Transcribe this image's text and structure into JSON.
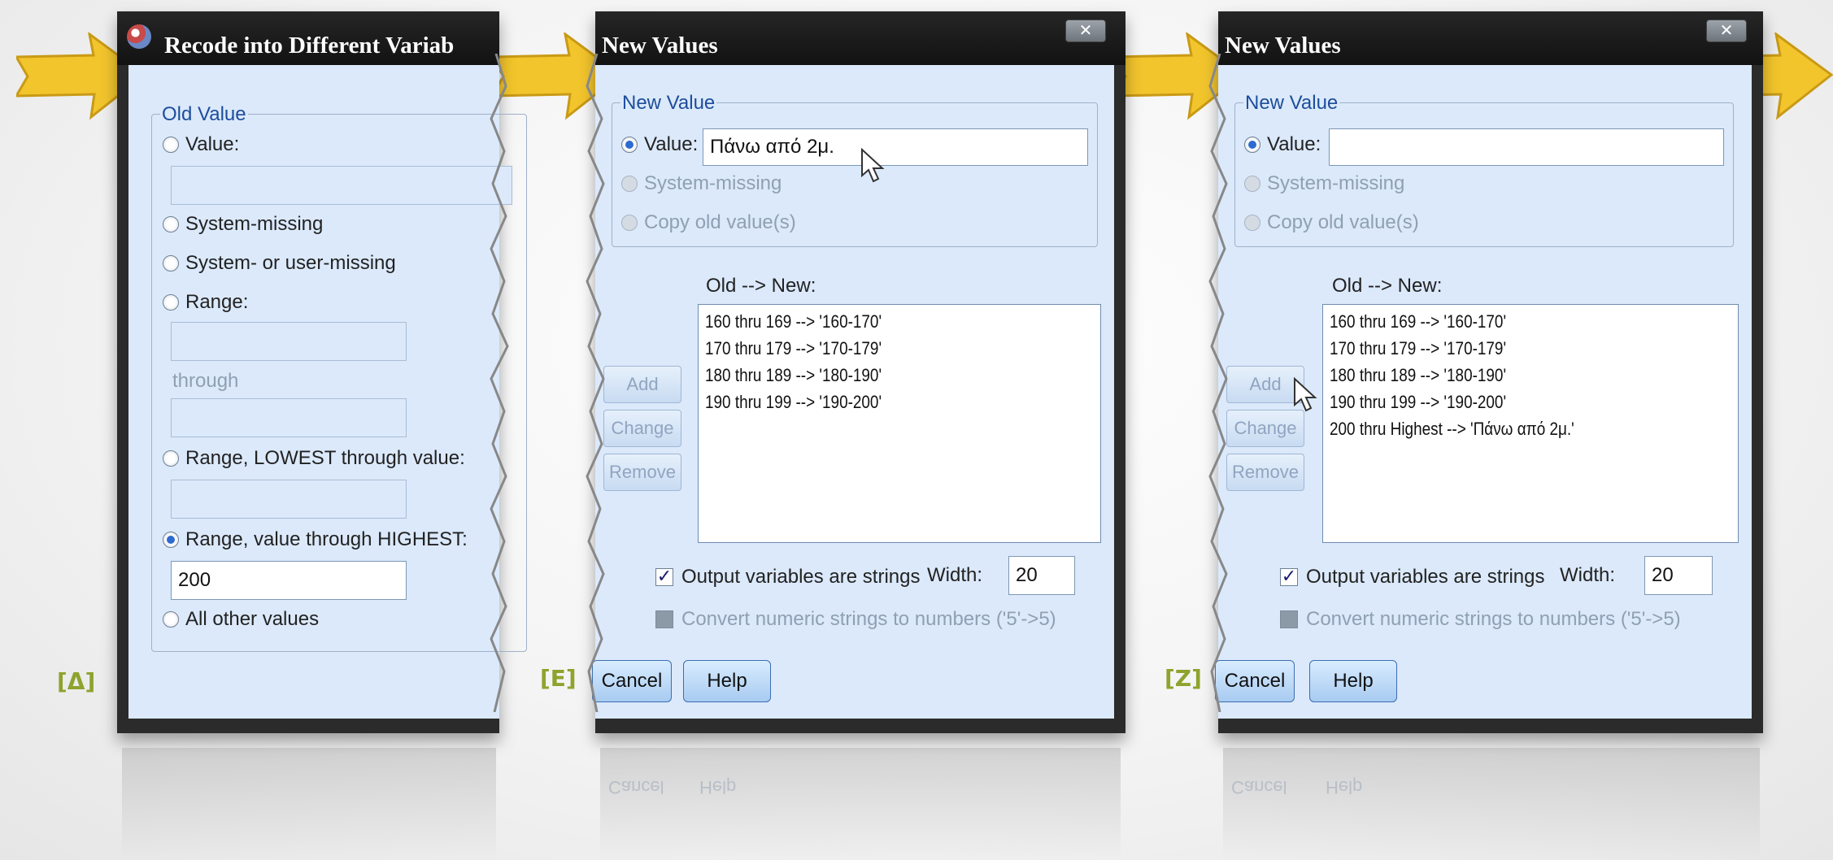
{
  "panel1": {
    "title": "Recode into Different Variab",
    "old_value_group": "Old Value",
    "opt_value": "Value:",
    "opt_system_missing": "System-missing",
    "opt_sys_user_missing": "System- or user-missing",
    "opt_range": "Range:",
    "through": "through",
    "opt_lowest": "Range, LOWEST through value:",
    "opt_highest": "Range, value through HIGHEST:",
    "highest_value": "200",
    "opt_all_other": "All other values",
    "caption": "[Δ]"
  },
  "panel2": {
    "title": "New Values",
    "close": "✕",
    "new_value_group": "New Value",
    "opt_value": "Value:",
    "value_input": "Πάνω από 2μ.",
    "opt_system_missing": "System-missing",
    "opt_copy_old": "Copy old value(s)",
    "list_label": "Old --> New:",
    "list_items": [
      "160 thru 169 --> '160-170'",
      "170 thru 179 --> '170-179'",
      "180 thru 189 --> '180-190'",
      "190 thru 199 --> '190-200'"
    ],
    "add": "Add",
    "change": "Change",
    "remove": "Remove",
    "output_strings": "Output variables are strings",
    "width_label": "Width:",
    "width_value": "20",
    "convert_numeric": "Convert numeric strings to numbers ('5'->5)",
    "cancel": "Cancel",
    "help": "Help",
    "caption": "[E]"
  },
  "panel3": {
    "title": "New Values",
    "close": "✕",
    "new_value_group": "New Value",
    "opt_value": "Value:",
    "value_input": "",
    "opt_system_missing": "System-missing",
    "opt_copy_old": "Copy old value(s)",
    "list_label": "Old --> New:",
    "list_items": [
      "160 thru 169 --> '160-170'",
      "170 thru 179 --> '170-179'",
      "180 thru 189 --> '180-190'",
      "190 thru 199 --> '190-200'",
      "200 thru Highest --> 'Πάνω από 2μ.'"
    ],
    "add": "Add",
    "change": "Change",
    "remove": "Remove",
    "output_strings": "Output variables are strings",
    "width_label": "Width:",
    "width_value": "20",
    "convert_numeric": "Convert numeric strings to numbers ('5'->5)",
    "cancel": "Cancel",
    "help": "Help",
    "caption": "[Z]"
  },
  "colors": {
    "arrow": "#f2c52d",
    "titlebar": "#1a1a1a",
    "client": "#dbe9fb",
    "caption": "#8ea32e"
  }
}
